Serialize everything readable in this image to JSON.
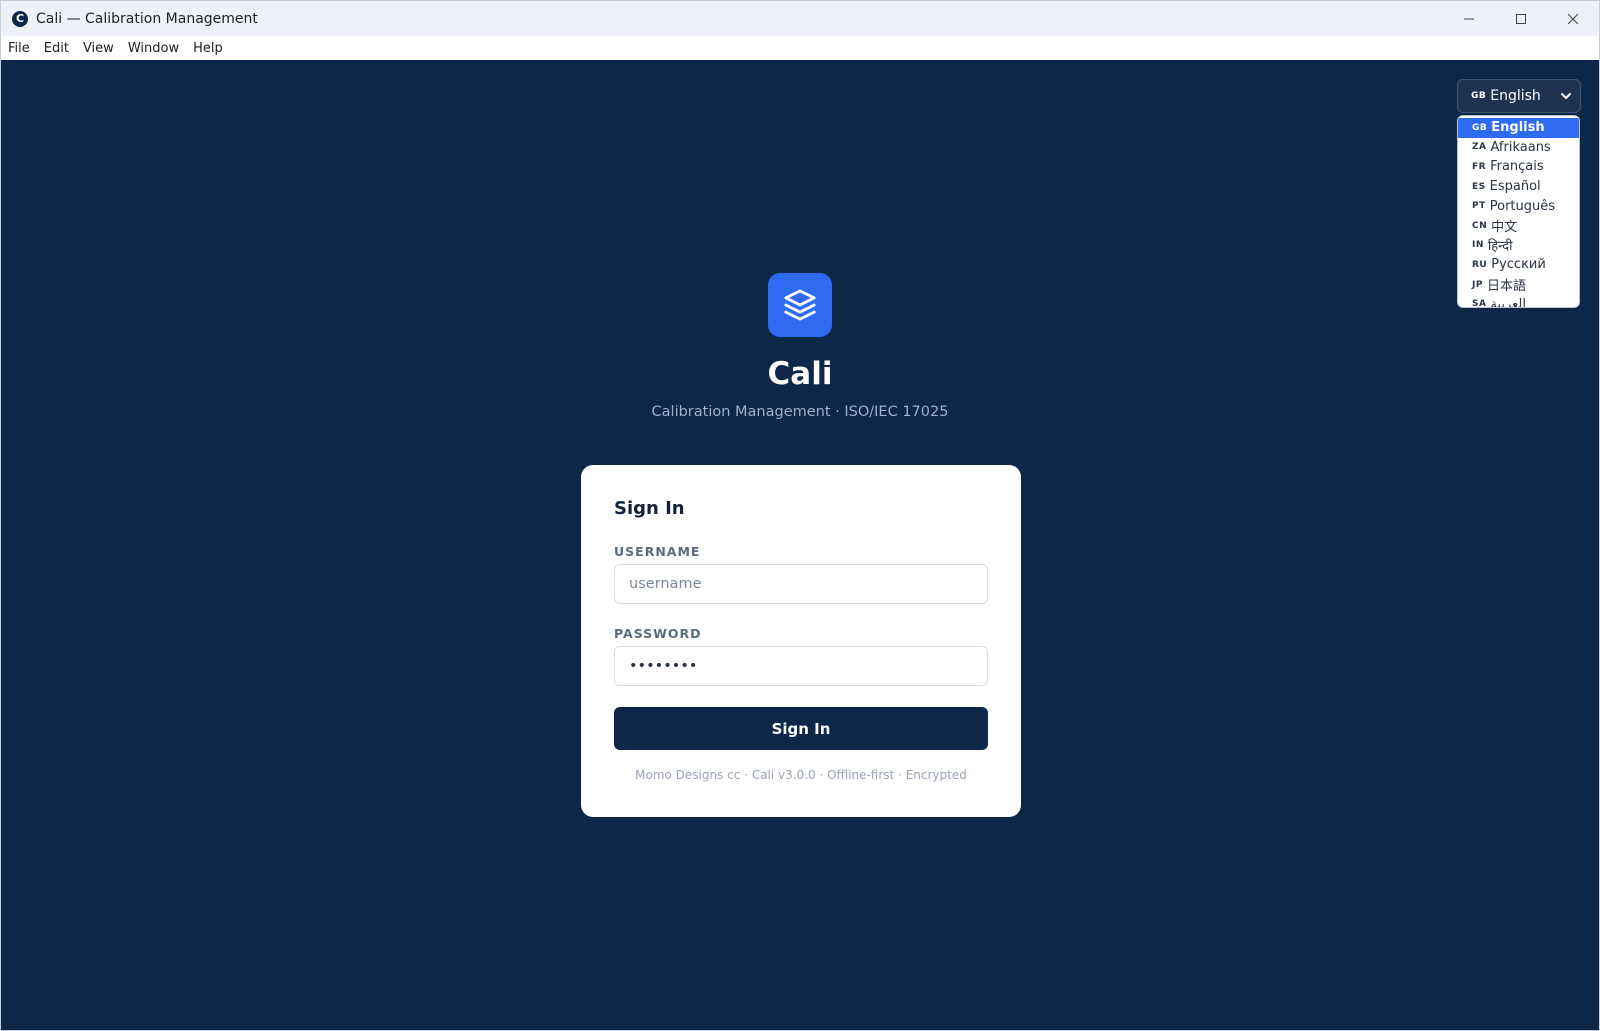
{
  "window": {
    "title": "Cali — Calibration Management",
    "app_icon_letter": "C"
  },
  "menu": [
    "File",
    "Edit",
    "View",
    "Window",
    "Help"
  ],
  "brand": {
    "name": "Cali",
    "subtitle": "Calibration Management · ISO/IEC 17025",
    "logo_icon": "layers-icon",
    "logo_color": "#2f6bf0"
  },
  "login": {
    "title": "Sign In",
    "username_label": "USERNAME",
    "username_placeholder": "username",
    "username_value": "",
    "password_label": "PASSWORD",
    "password_value": "password",
    "submit_label": "Sign In",
    "footer": "Momo Designs cc · Cali v3.0.0 · Offline-first · Encrypted"
  },
  "language": {
    "selected_code": "GB",
    "selected_label": "English",
    "options": [
      {
        "code": "GB",
        "label": "English"
      },
      {
        "code": "ZA",
        "label": "Afrikaans"
      },
      {
        "code": "FR",
        "label": "Français"
      },
      {
        "code": "ES",
        "label": "Español"
      },
      {
        "code": "PT",
        "label": "Português"
      },
      {
        "code": "CN",
        "label": "中文"
      },
      {
        "code": "IN",
        "label": "हिन्दी"
      },
      {
        "code": "RU",
        "label": "Русский"
      },
      {
        "code": "JP",
        "label": "日本語"
      },
      {
        "code": "SA",
        "label": "العربية"
      }
    ]
  },
  "colors": {
    "background": "#0c2748",
    "accent": "#2f6bf0",
    "card": "#ffffff"
  }
}
